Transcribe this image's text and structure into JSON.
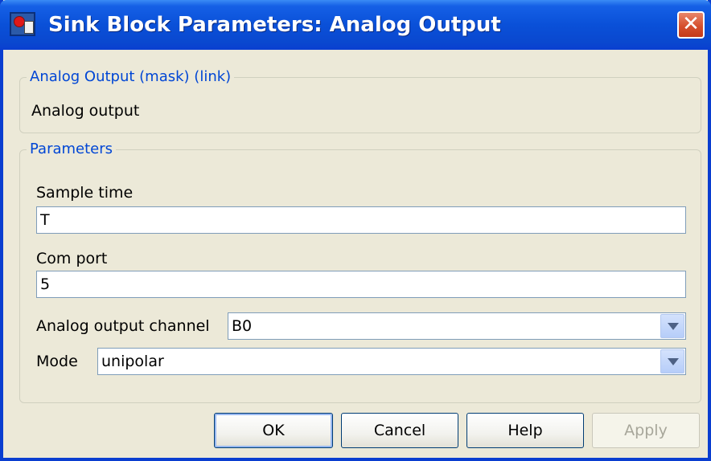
{
  "window": {
    "title": "Sink Block Parameters: Analog Output",
    "close_symbol": "✕",
    "icon": "simulink-block-icon"
  },
  "description_group": {
    "legend": "Analog Output (mask) (link)",
    "text": "Analog output"
  },
  "parameters_group": {
    "legend": "Parameters",
    "sample_time": {
      "label": "Sample time",
      "value": "T"
    },
    "com_port": {
      "label": "Com port",
      "value": "5"
    },
    "analog_output_channel": {
      "label": "Analog output channel",
      "value": "B0"
    },
    "mode": {
      "label": "Mode",
      "value": "unipolar"
    }
  },
  "buttons": {
    "ok": "OK",
    "cancel": "Cancel",
    "help": "Help",
    "apply": "Apply"
  },
  "colors": {
    "titlebar": "#0a50d8",
    "group_legend": "#0046d5",
    "dialog_bg": "#ece9d8"
  }
}
